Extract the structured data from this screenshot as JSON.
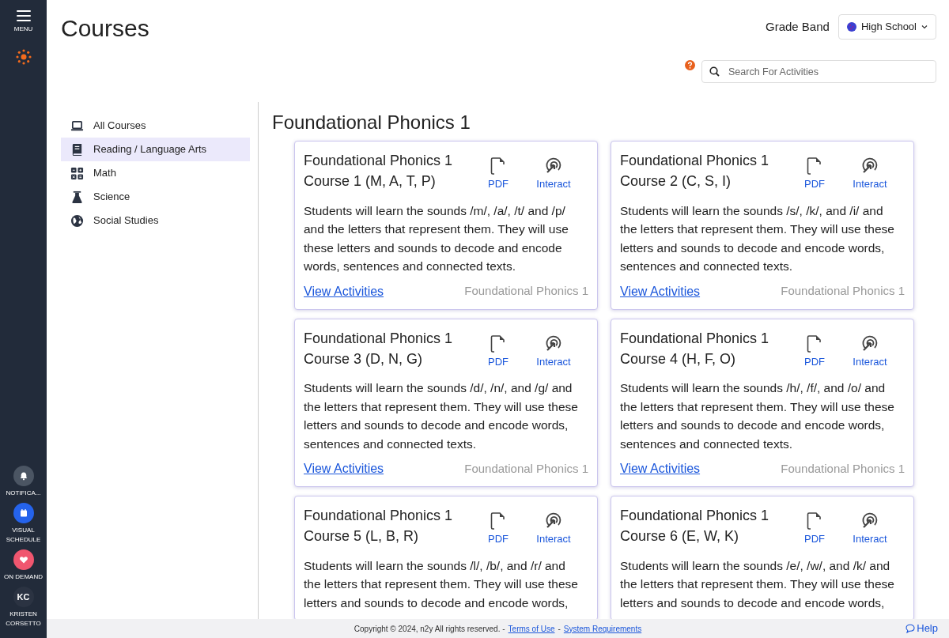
{
  "sidebar": {
    "menu_label": "MENU",
    "bottom_items": [
      {
        "kind": "notifications",
        "label": "NOTIFICA...",
        "color": "#4b5563"
      },
      {
        "kind": "schedule",
        "label": "VISUAL SCHEDULE",
        "color": "#2563eb"
      },
      {
        "kind": "on_demand",
        "label": "ON DEMAND",
        "color": "#f0566f"
      },
      {
        "kind": "user",
        "initials": "KC",
        "label": "KRISTEN CORSETTO",
        "color": "#2b3342"
      }
    ]
  },
  "header": {
    "title": "Courses",
    "grade_band_label": "Grade Band",
    "grade_band_value": "High School"
  },
  "search": {
    "placeholder": "Search For Activities"
  },
  "categories": [
    {
      "label": "All Courses",
      "selected": false
    },
    {
      "label": "Reading / Language Arts",
      "selected": true
    },
    {
      "label": "Math",
      "selected": false
    },
    {
      "label": "Science",
      "selected": false
    },
    {
      "label": "Social Studies",
      "selected": false
    }
  ],
  "section_title": "Foundational Phonics 1",
  "courses": [
    {
      "title": "Foundational Phonics 1",
      "subtitle": "Course 1 (M, A, T, P)",
      "pdf_label": "PDF",
      "interact_label": "Interact",
      "description": "Students will learn the sounds /m/, /a/, /t/ and /p/ and the letters that represent them. They will use these letters and sounds to decode and encode words, sentences and connected texts.",
      "link": "View Activities",
      "tag": "Foundational Phonics 1"
    },
    {
      "title": "Foundational Phonics 1",
      "subtitle": "Course 2 (C, S, I)",
      "pdf_label": "PDF",
      "interact_label": "Interact",
      "description": "Students will learn the sounds /s/, /k/, and /i/ and the letters that represent them. They will use these letters and sounds to decode and encode words, sentences and connected texts.",
      "link": "View Activities",
      "tag": "Foundational Phonics 1"
    },
    {
      "title": "Foundational Phonics 1",
      "subtitle": "Course 3 (D, N, G)",
      "pdf_label": "PDF",
      "interact_label": "Interact",
      "description": "Students will learn the sounds /d/, /n/, and /g/ and the letters that represent them. They will use these letters and sounds to decode and encode words, sentences and connected texts.",
      "link": "View Activities",
      "tag": "Foundational Phonics 1"
    },
    {
      "title": "Foundational Phonics 1",
      "subtitle": "Course 4 (H, F, O)",
      "pdf_label": "PDF",
      "interact_label": "Interact",
      "description": "Students will learn the sounds /h/, /f/, and /o/ and the letters that represent them. They will use these letters and sounds to decode and encode words, sentences and connected texts.",
      "link": "View Activities",
      "tag": "Foundational Phonics 1"
    },
    {
      "title": "Foundational Phonics 1",
      "subtitle": "Course 5 (L, B, R)",
      "pdf_label": "PDF",
      "interact_label": "Interact",
      "description": "Students will learn the sounds /l/, /b/, and /r/ and the letters that represent them. They will use these letters and sounds to decode and encode words,"
    },
    {
      "title": "Foundational Phonics 1",
      "subtitle": "Course 6 (E, W, K)",
      "pdf_label": "PDF",
      "interact_label": "Interact",
      "description": "Students will learn the sounds /e/, /w/, and /k/ and the letters that represent them. They will use these letters and sounds to decode and encode words,"
    }
  ],
  "footer": {
    "copyright": "Copyright © 2024, n2y All rights reserved. -",
    "terms": "Terms of Use",
    "separator": "-",
    "requirements": "System Requirements",
    "help": "Help"
  }
}
